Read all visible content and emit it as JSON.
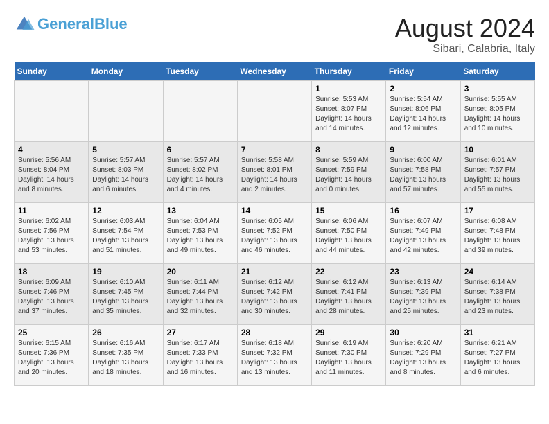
{
  "header": {
    "logo_general": "General",
    "logo_blue": "Blue",
    "title": "August 2024",
    "subtitle": "Sibari, Calabria, Italy"
  },
  "weekdays": [
    "Sunday",
    "Monday",
    "Tuesday",
    "Wednesday",
    "Thursday",
    "Friday",
    "Saturday"
  ],
  "weeks": [
    [
      {
        "day": "",
        "info": ""
      },
      {
        "day": "",
        "info": ""
      },
      {
        "day": "",
        "info": ""
      },
      {
        "day": "",
        "info": ""
      },
      {
        "day": "1",
        "info": "Sunrise: 5:53 AM\nSunset: 8:07 PM\nDaylight: 14 hours and 14 minutes."
      },
      {
        "day": "2",
        "info": "Sunrise: 5:54 AM\nSunset: 8:06 PM\nDaylight: 14 hours and 12 minutes."
      },
      {
        "day": "3",
        "info": "Sunrise: 5:55 AM\nSunset: 8:05 PM\nDaylight: 14 hours and 10 minutes."
      }
    ],
    [
      {
        "day": "4",
        "info": "Sunrise: 5:56 AM\nSunset: 8:04 PM\nDaylight: 14 hours and 8 minutes."
      },
      {
        "day": "5",
        "info": "Sunrise: 5:57 AM\nSunset: 8:03 PM\nDaylight: 14 hours and 6 minutes."
      },
      {
        "day": "6",
        "info": "Sunrise: 5:57 AM\nSunset: 8:02 PM\nDaylight: 14 hours and 4 minutes."
      },
      {
        "day": "7",
        "info": "Sunrise: 5:58 AM\nSunset: 8:01 PM\nDaylight: 14 hours and 2 minutes."
      },
      {
        "day": "8",
        "info": "Sunrise: 5:59 AM\nSunset: 7:59 PM\nDaylight: 14 hours and 0 minutes."
      },
      {
        "day": "9",
        "info": "Sunrise: 6:00 AM\nSunset: 7:58 PM\nDaylight: 13 hours and 57 minutes."
      },
      {
        "day": "10",
        "info": "Sunrise: 6:01 AM\nSunset: 7:57 PM\nDaylight: 13 hours and 55 minutes."
      }
    ],
    [
      {
        "day": "11",
        "info": "Sunrise: 6:02 AM\nSunset: 7:56 PM\nDaylight: 13 hours and 53 minutes."
      },
      {
        "day": "12",
        "info": "Sunrise: 6:03 AM\nSunset: 7:54 PM\nDaylight: 13 hours and 51 minutes."
      },
      {
        "day": "13",
        "info": "Sunrise: 6:04 AM\nSunset: 7:53 PM\nDaylight: 13 hours and 49 minutes."
      },
      {
        "day": "14",
        "info": "Sunrise: 6:05 AM\nSunset: 7:52 PM\nDaylight: 13 hours and 46 minutes."
      },
      {
        "day": "15",
        "info": "Sunrise: 6:06 AM\nSunset: 7:50 PM\nDaylight: 13 hours and 44 minutes."
      },
      {
        "day": "16",
        "info": "Sunrise: 6:07 AM\nSunset: 7:49 PM\nDaylight: 13 hours and 42 minutes."
      },
      {
        "day": "17",
        "info": "Sunrise: 6:08 AM\nSunset: 7:48 PM\nDaylight: 13 hours and 39 minutes."
      }
    ],
    [
      {
        "day": "18",
        "info": "Sunrise: 6:09 AM\nSunset: 7:46 PM\nDaylight: 13 hours and 37 minutes."
      },
      {
        "day": "19",
        "info": "Sunrise: 6:10 AM\nSunset: 7:45 PM\nDaylight: 13 hours and 35 minutes."
      },
      {
        "day": "20",
        "info": "Sunrise: 6:11 AM\nSunset: 7:44 PM\nDaylight: 13 hours and 32 minutes."
      },
      {
        "day": "21",
        "info": "Sunrise: 6:12 AM\nSunset: 7:42 PM\nDaylight: 13 hours and 30 minutes."
      },
      {
        "day": "22",
        "info": "Sunrise: 6:12 AM\nSunset: 7:41 PM\nDaylight: 13 hours and 28 minutes."
      },
      {
        "day": "23",
        "info": "Sunrise: 6:13 AM\nSunset: 7:39 PM\nDaylight: 13 hours and 25 minutes."
      },
      {
        "day": "24",
        "info": "Sunrise: 6:14 AM\nSunset: 7:38 PM\nDaylight: 13 hours and 23 minutes."
      }
    ],
    [
      {
        "day": "25",
        "info": "Sunrise: 6:15 AM\nSunset: 7:36 PM\nDaylight: 13 hours and 20 minutes."
      },
      {
        "day": "26",
        "info": "Sunrise: 6:16 AM\nSunset: 7:35 PM\nDaylight: 13 hours and 18 minutes."
      },
      {
        "day": "27",
        "info": "Sunrise: 6:17 AM\nSunset: 7:33 PM\nDaylight: 13 hours and 16 minutes."
      },
      {
        "day": "28",
        "info": "Sunrise: 6:18 AM\nSunset: 7:32 PM\nDaylight: 13 hours and 13 minutes."
      },
      {
        "day": "29",
        "info": "Sunrise: 6:19 AM\nSunset: 7:30 PM\nDaylight: 13 hours and 11 minutes."
      },
      {
        "day": "30",
        "info": "Sunrise: 6:20 AM\nSunset: 7:29 PM\nDaylight: 13 hours and 8 minutes."
      },
      {
        "day": "31",
        "info": "Sunrise: 6:21 AM\nSunset: 7:27 PM\nDaylight: 13 hours and 6 minutes."
      }
    ]
  ]
}
